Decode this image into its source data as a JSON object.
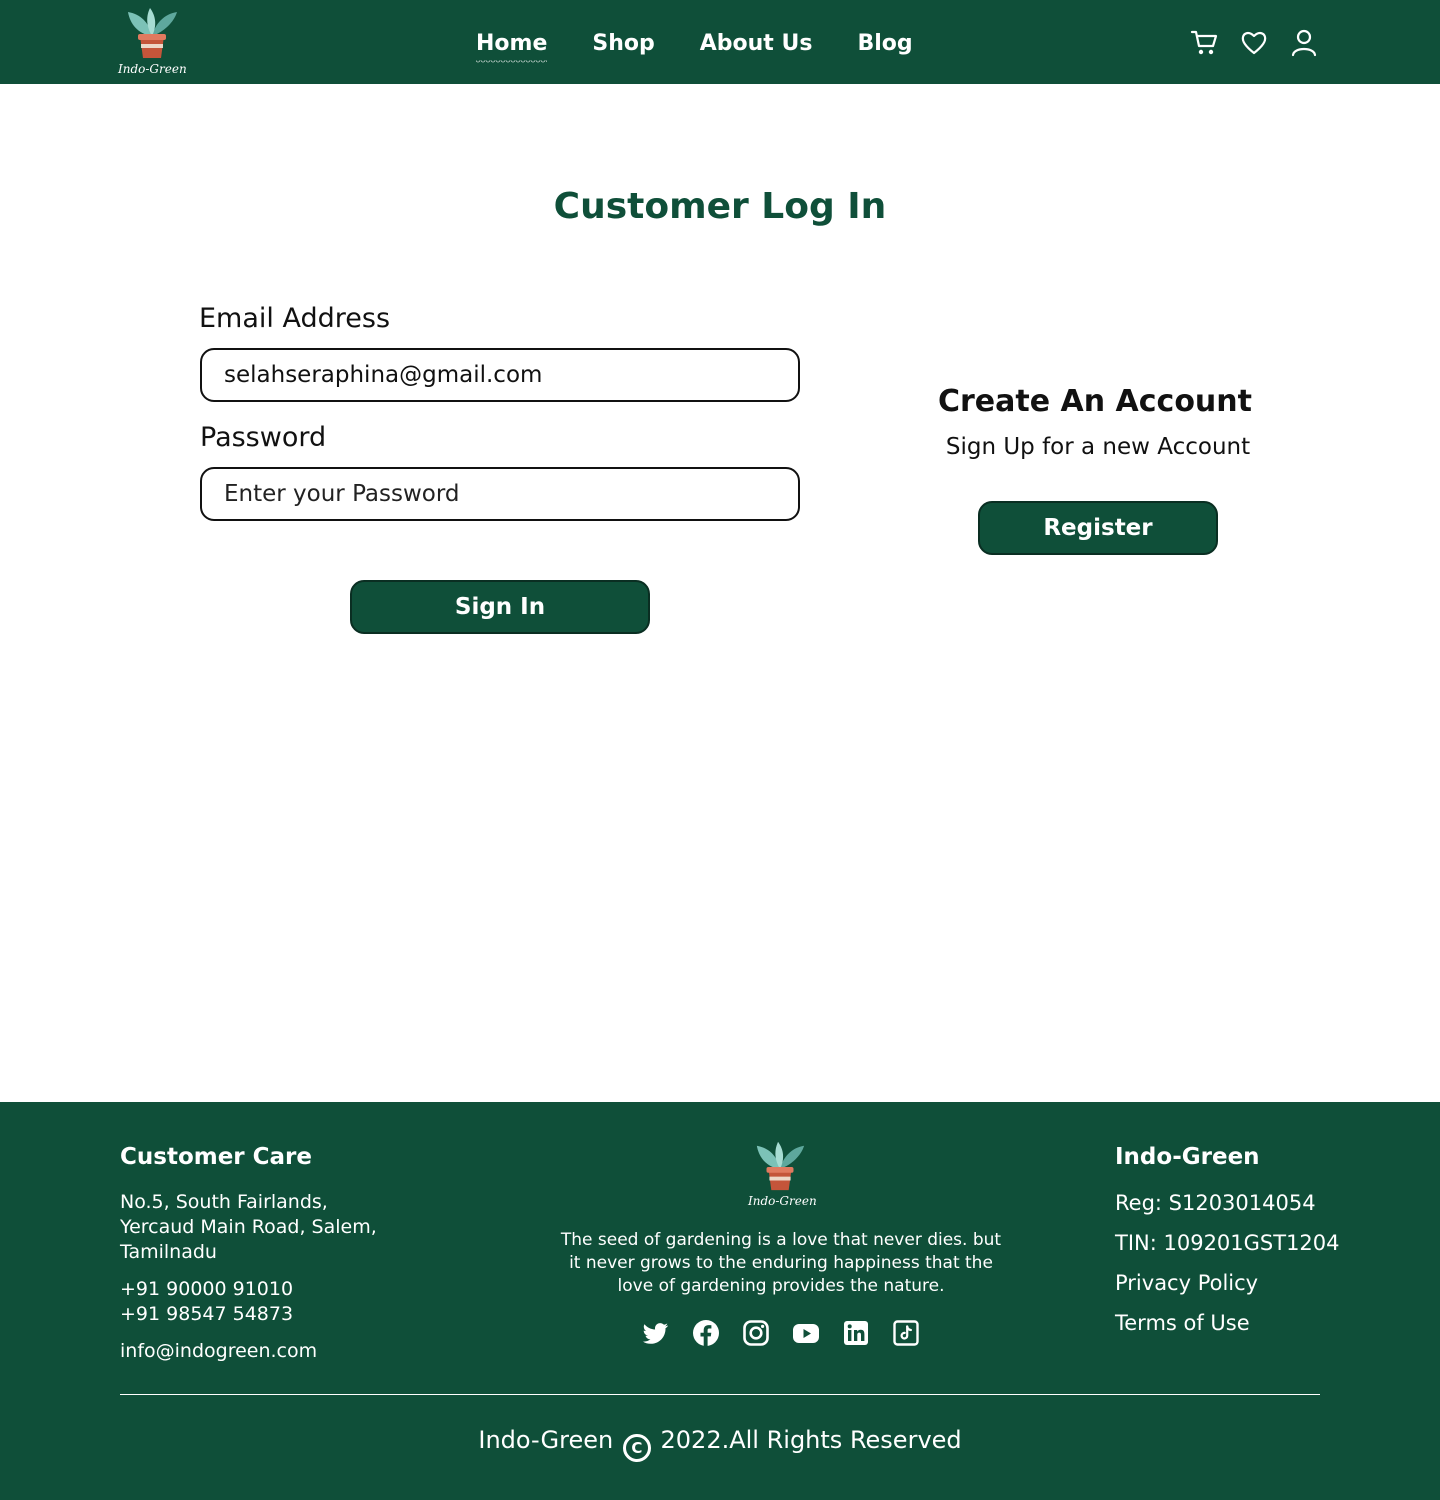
{
  "brand": {
    "name": "Indo-Green",
    "logo_text": "Indo-Green",
    "colors": {
      "primary": "#0f4f39",
      "text": "#111111",
      "pot": "#c4553a",
      "leaf": "#6fb5ab"
    }
  },
  "nav": {
    "links": [
      "Home",
      "Shop",
      "About Us",
      "Blog"
    ],
    "active": "Home",
    "icons": [
      "cart-icon",
      "heart-icon",
      "user-icon"
    ]
  },
  "login": {
    "title": "Customer Log In",
    "email_label": "Email Address",
    "email_value": "selahseraphina@gmail.com",
    "password_label": "Password",
    "password_placeholder": "Enter your Password",
    "sign_in_label": "Sign In"
  },
  "register": {
    "title": "Create An Account",
    "subtitle": "Sign Up for a new Account",
    "button_label": "Register"
  },
  "footer": {
    "customer_care": {
      "heading": "Customer Care",
      "address_lines": [
        "No.5, South Fairlands,",
        "Yercaud Main Road, Salem,",
        "Tamilnadu"
      ],
      "phones": [
        "+91 90000 91010",
        "+91 98547 54873"
      ],
      "email": "info@indogreen.com"
    },
    "tagline": "The seed of gardening is a love that never dies. but it never grows to the enduring happiness that the love of gardening provides the nature.",
    "socials": [
      "twitter-icon",
      "facebook-icon",
      "instagram-icon",
      "youtube-icon",
      "linkedin-icon",
      "tiktok-icon"
    ],
    "company": {
      "heading": "Indo-Green",
      "reg": "Reg: S1203014054",
      "tin": "TIN: 109201GST1204",
      "privacy": "Privacy Policy",
      "terms": "Terms of Use"
    },
    "copyright": {
      "brand": "Indo-Green",
      "symbol": "C",
      "text": "2022.All Rights Reserved"
    }
  }
}
